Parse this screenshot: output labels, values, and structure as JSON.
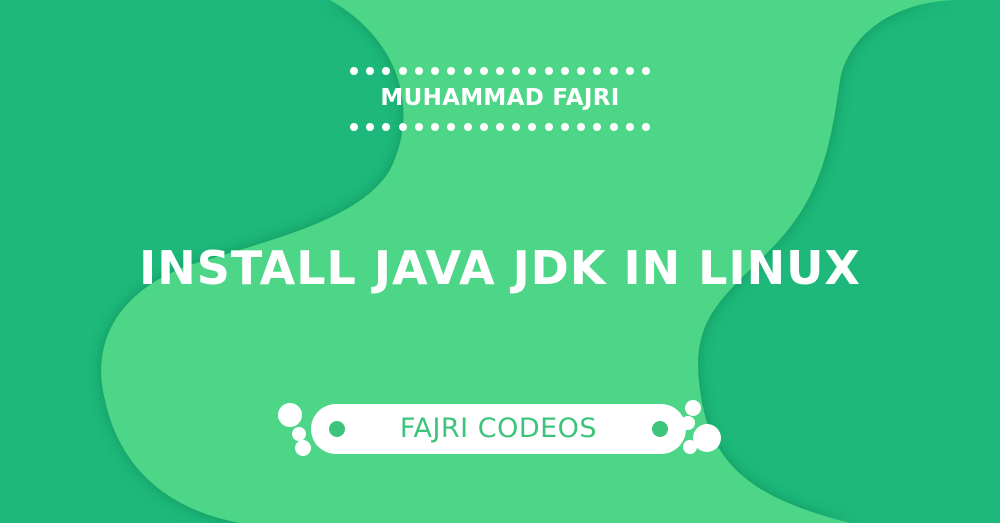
{
  "author": {
    "name": "MUHAMMAD FAJRI"
  },
  "title": "INSTALL JAVA JDK IN LINUX",
  "badge": {
    "label": "FAJRI CODEOS"
  },
  "colors": {
    "dark_green": "#1db87a",
    "light_green": "#4dd687",
    "accent_green": "#3dc47c",
    "white": "#ffffff"
  }
}
